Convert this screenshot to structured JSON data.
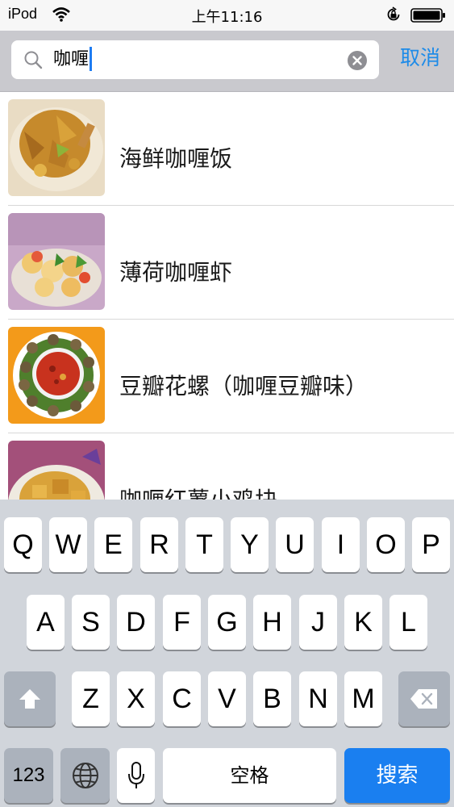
{
  "status_bar": {
    "device": "iPod",
    "time": "上午11:16",
    "icons": [
      "wifi-icon",
      "orientation-lock-icon",
      "battery-icon"
    ]
  },
  "search": {
    "value": "咖喱",
    "icons": [
      "search-icon",
      "clear-icon"
    ],
    "cancel_label": "取消"
  },
  "results": [
    {
      "title": "海鲜咖喱饭",
      "image": "food-thumbnail"
    },
    {
      "title": "薄荷咖喱虾",
      "image": "food-thumbnail"
    },
    {
      "title": "豆瓣花螺（咖喱豆瓣味）",
      "image": "food-thumbnail"
    },
    {
      "title": "咖喱红薯小鸡块",
      "image": "food-thumbnail"
    }
  ],
  "keyboard": {
    "row1": [
      "Q",
      "W",
      "E",
      "R",
      "T",
      "Y",
      "U",
      "I",
      "O",
      "P"
    ],
    "row2": [
      "A",
      "S",
      "D",
      "F",
      "G",
      "H",
      "J",
      "K",
      "L"
    ],
    "row3": [
      "Z",
      "X",
      "C",
      "V",
      "B",
      "N",
      "M"
    ],
    "numbers_label": "123",
    "space_label": "空格",
    "search_label": "搜索",
    "icons": [
      "shift-icon",
      "backspace-icon",
      "globe-icon",
      "microphone-icon"
    ]
  },
  "colors": {
    "accent": "#1e8be8",
    "search_key": "#1a7ff0",
    "keyboard_bg": "#d1d5db",
    "header_bg": "#c9c9ce"
  }
}
